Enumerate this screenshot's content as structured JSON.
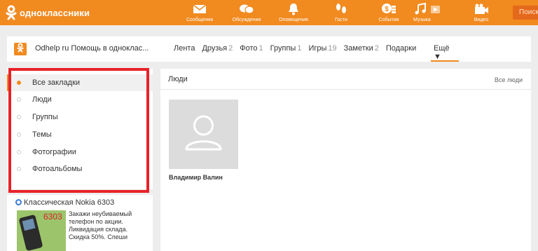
{
  "header": {
    "brand": "одноклассники",
    "nav": [
      {
        "label": "Сообщения",
        "icon": "envelope-icon"
      },
      {
        "label": "Обсуждения",
        "icon": "chat-bubbles-icon"
      },
      {
        "label": "Оповещения",
        "icon": "bell-icon"
      },
      {
        "label": "Гости",
        "icon": "footprints-icon"
      },
      {
        "label": "События",
        "icon": "coins-icon"
      },
      {
        "label": "Музыка",
        "icon": "music-note-icon"
      },
      {
        "label": "Видео",
        "icon": "video-camera-icon"
      }
    ],
    "search_label": "Поиск",
    "accent_color": "#f18a1f"
  },
  "profile": {
    "name": "Odhelp ru Помощь в одноклас...",
    "tabs": [
      {
        "label": "Лента",
        "count": ""
      },
      {
        "label": "Друзья",
        "count": "2"
      },
      {
        "label": "Фото",
        "count": "1"
      },
      {
        "label": "Группы",
        "count": "1"
      },
      {
        "label": "Игры",
        "count": "19"
      },
      {
        "label": "Заметки",
        "count": "2"
      },
      {
        "label": "Подарки",
        "count": ""
      }
    ],
    "more_label": "Ещё ▼"
  },
  "sidebar": {
    "items": [
      {
        "label": "Все закладки",
        "active": true
      },
      {
        "label": "Люди",
        "active": false
      },
      {
        "label": "Группы",
        "active": false
      },
      {
        "label": "Темы",
        "active": false
      },
      {
        "label": "Фотографии",
        "active": false
      },
      {
        "label": "Фотоальбомы",
        "active": false
      }
    ],
    "highlight_color": "#e8222a"
  },
  "ad": {
    "title": "Классическая Nokia 6303",
    "price": "6303",
    "text_lines": [
      "Закажи неубиваемый",
      "телефон по акции.",
      "Ликвидация склада.",
      "Скидка 50%. Спеши"
    ]
  },
  "main": {
    "section_title": "Люди",
    "all_link": "Все люди",
    "people": [
      {
        "name": "Владимир Валин"
      }
    ]
  }
}
